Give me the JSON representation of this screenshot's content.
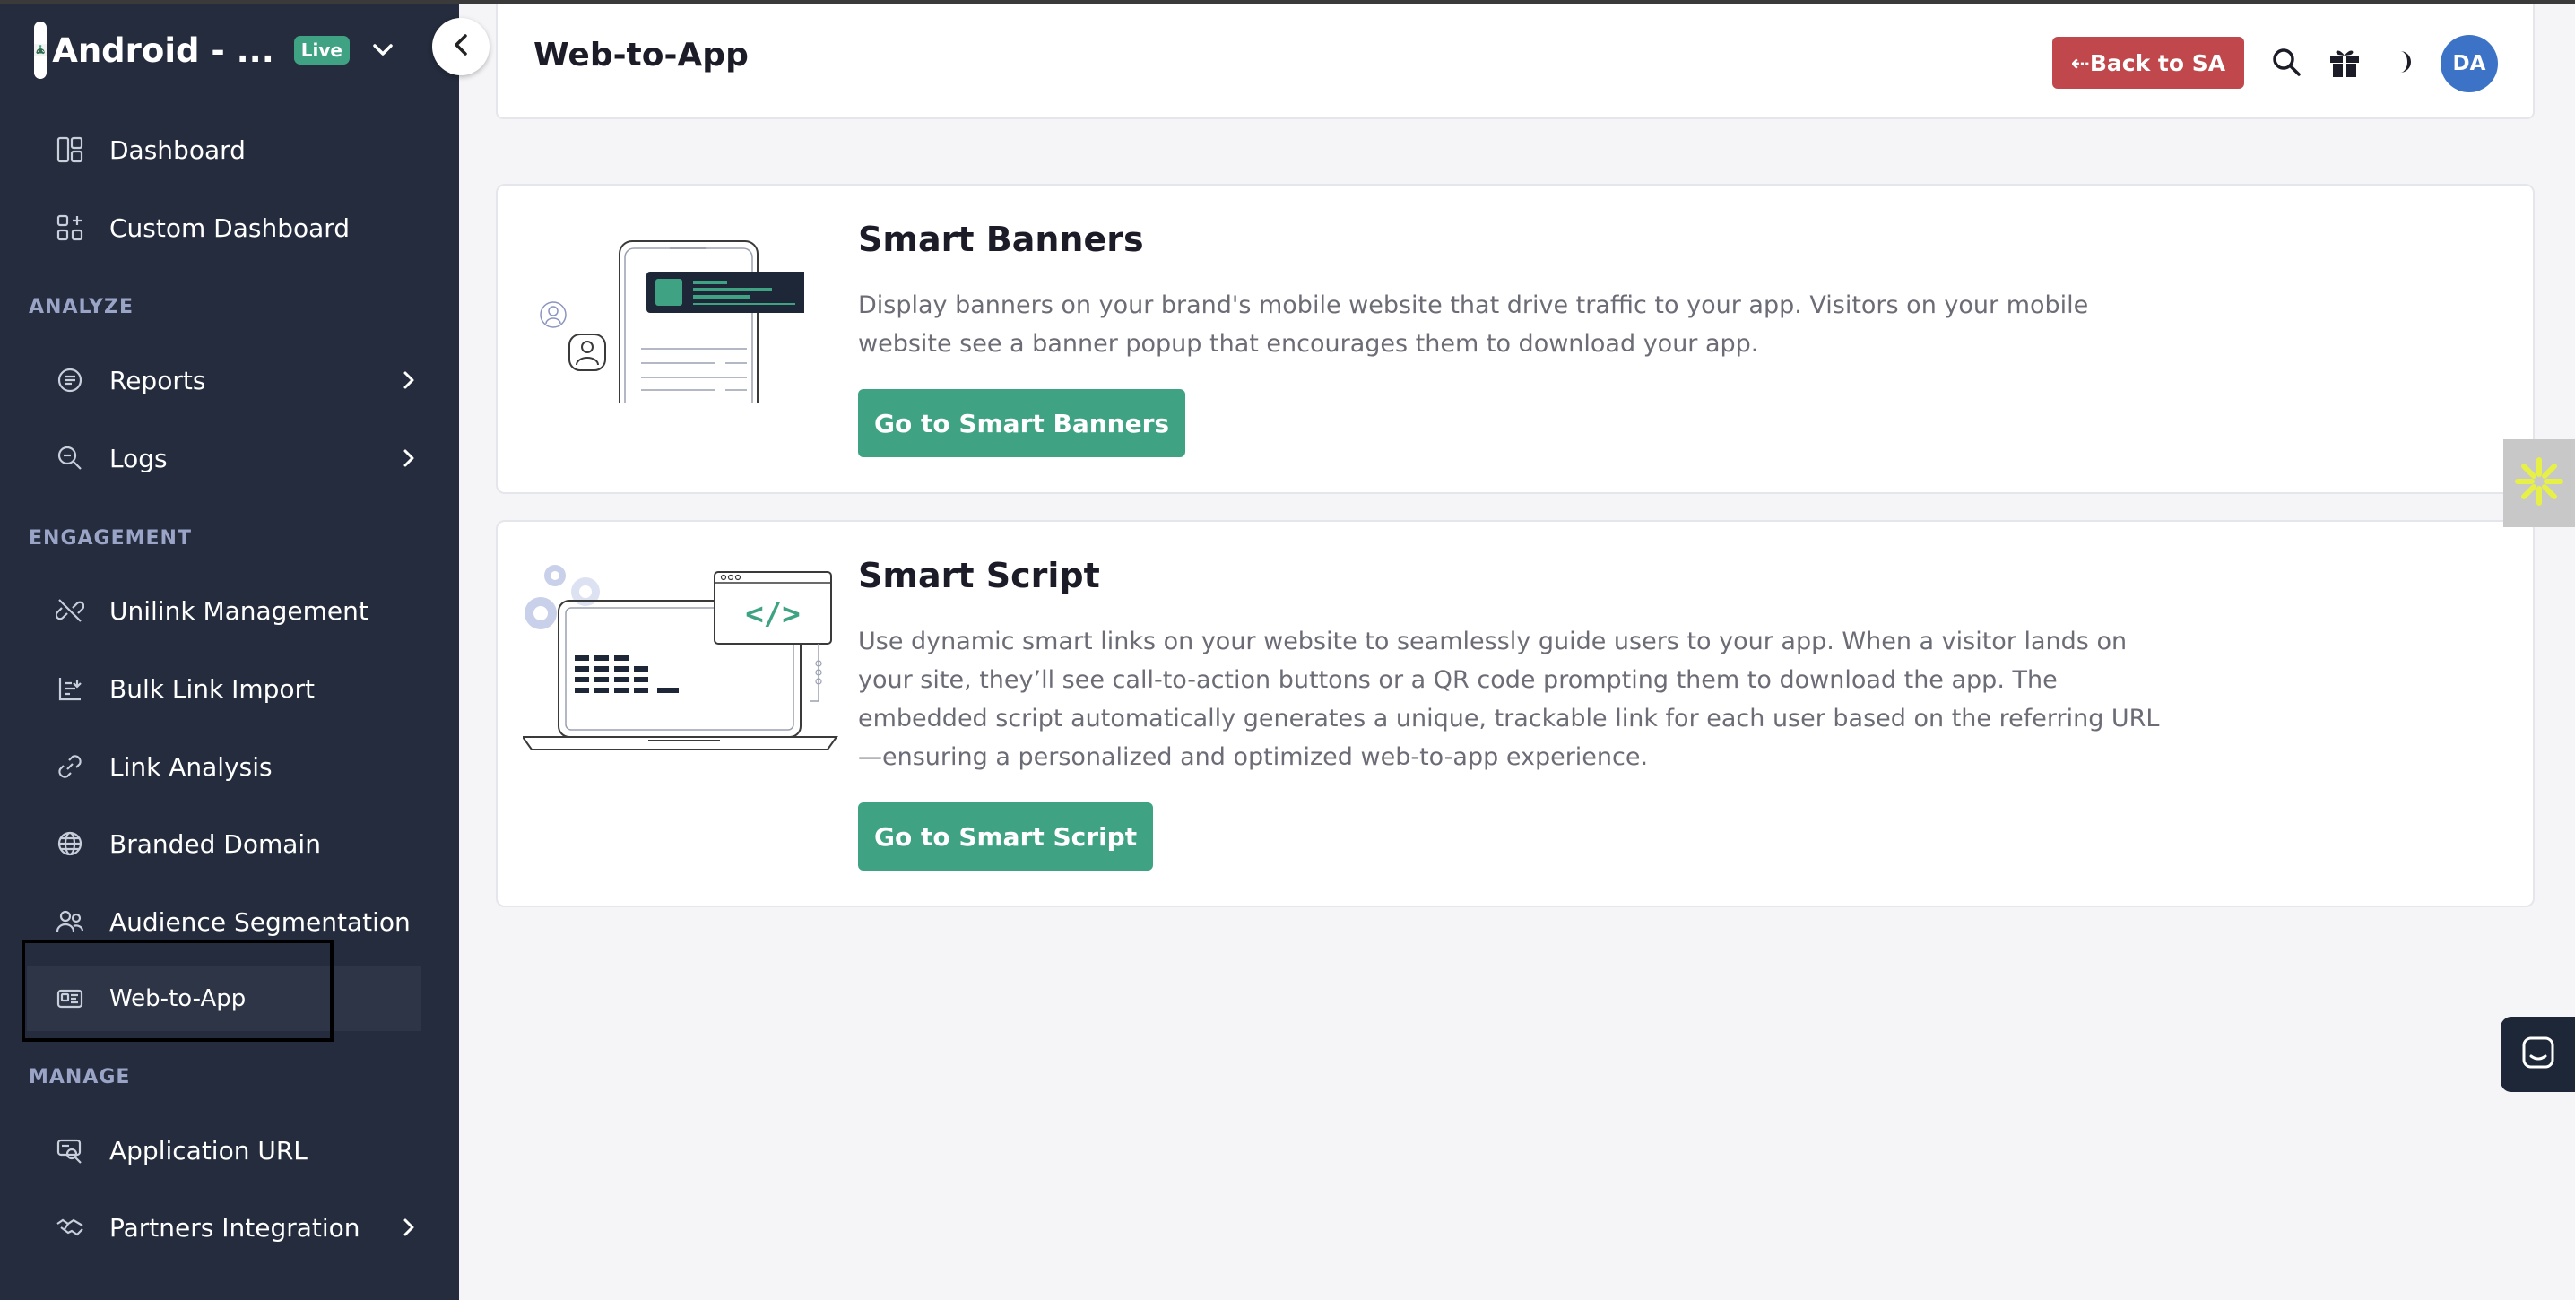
{
  "app": {
    "name": "Android - ...",
    "status_badge": "Live"
  },
  "sidebar": {
    "items_top": [
      {
        "label": "Dashboard",
        "icon": "dashboard-icon"
      },
      {
        "label": "Custom Dashboard",
        "icon": "custom-dashboard-icon"
      }
    ],
    "sections": {
      "analyze": "ANALYZE",
      "engagement": "ENGAGEMENT",
      "manage": "MANAGE"
    },
    "analyze_items": [
      {
        "label": "Reports",
        "icon": "reports-icon",
        "has_submenu": true
      },
      {
        "label": "Logs",
        "icon": "logs-icon",
        "has_submenu": true
      }
    ],
    "engagement_items": [
      {
        "label": "Unilink Management",
        "icon": "unilink-icon"
      },
      {
        "label": "Bulk Link Import",
        "icon": "bulk-import-icon"
      },
      {
        "label": "Link Analysis",
        "icon": "link-icon"
      },
      {
        "label": "Branded Domain",
        "icon": "globe-icon"
      },
      {
        "label": "Audience Segmentation",
        "icon": "audience-icon"
      },
      {
        "label": "Web-to-App",
        "icon": "web-to-app-icon",
        "active": true
      }
    ],
    "manage_items": [
      {
        "label": "Application URL",
        "icon": "application-url-icon"
      },
      {
        "label": "Partners Integration",
        "icon": "handshake-icon",
        "has_submenu": true
      }
    ]
  },
  "header": {
    "title": "Web-to-App",
    "back_button": "⇠Back to SA",
    "avatar_initials": "DA"
  },
  "cards": [
    {
      "title": "Smart Banners",
      "description": "Display banners on your brand's mobile website that drive traffic to your app. Visitors on your mobile website see a banner popup that encourages them to download your app.",
      "button": "Go to Smart Banners"
    },
    {
      "title": "Smart Script",
      "description": "Use dynamic smart links on your website to seamlessly guide users to your app. When a visitor lands on your site, they’ll see call-to-action buttons or a QR code prompting them to download the app. The embedded script automatically generates a unique, trackable link for each user based on the referring URL—ensuring a personalized and optimized web-to-app experience.",
      "button": "Go to Smart Script",
      "code_label": "</>"
    }
  ],
  "colors": {
    "sidebar_bg": "#242c3d",
    "accent_green": "#3fa383",
    "back_button_red": "#c0474b",
    "avatar_blue": "#3c73c7",
    "section_title": "#9aa4c7"
  }
}
